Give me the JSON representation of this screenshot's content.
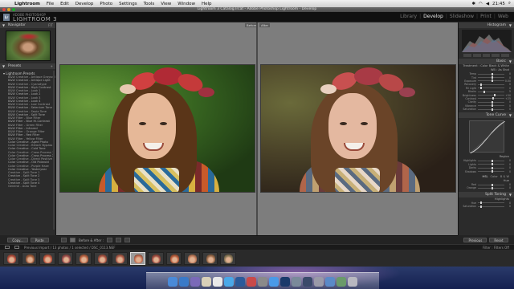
{
  "menubar": {
    "app": "Lightroom",
    "items": [
      "File",
      "Edit",
      "Develop",
      "Photo",
      "Settings",
      "Tools",
      "View",
      "Window",
      "Help"
    ],
    "clock": "21:45"
  },
  "window": {
    "title": "Lightroom 3 Catalog.lrcat - Adobe Photoshop Lightroom - Develop"
  },
  "identity": {
    "logo": "Lr",
    "subtitle": "ADOBE PHOTOSHOP",
    "app_name": "LIGHTROOM 3"
  },
  "modules": [
    "Library",
    "Develop",
    "Slideshow",
    "Print",
    "Web"
  ],
  "active_module": "Develop",
  "left_panel": {
    "navigator_header": "Navigator",
    "navigator_zoom": "FIT",
    "presets_header": "Presets",
    "folder": "Lightroom Presets",
    "presets": [
      "B&W Creative - Antique Grayscale",
      "B&W Creative - Antique Light",
      "B&W Creative - Cyanotype",
      "B&W Creative - High Contrast",
      "B&W Creative - Look 1",
      "B&W Creative - Look 2",
      "B&W Creative - Look 3",
      "B&W Creative - Look 4",
      "B&W Creative - Low Contrast",
      "B&W Creative - Selenium Tone",
      "B&W Creative - Sepia Tone",
      "B&W Creative - Split Tone",
      "B&W Filter - Blue Filter",
      "B&W Filter - Blue Hi-Contrast",
      "B&W Filter - Green Filter",
      "B&W Filter - Infrared",
      "B&W Filter - Orange Filter",
      "B&W Filter - Red Filter",
      "B&W Filter - Yellow Filter",
      "Color Creative - Aged Photo",
      "Color Creative - Bleach Bypass",
      "Color Creative - Cold Tone",
      "Color Creative - Cross Process 1",
      "Color Creative - Cross Process 2",
      "Color Creative - Direct Positive",
      "Color Creative - Old Polaroid",
      "Color Creative - Purple Haze",
      "Color Creative - Yesteryear",
      "Creative - Split Tone 1",
      "Creative - Split Tone 2",
      "Creative - Split Tone 3",
      "Creative - Split Tone 4",
      "General - Auto Tone"
    ],
    "copy_button": "Copy...",
    "paste_button": "Paste"
  },
  "center": {
    "before_label": "Before",
    "after_label": "After",
    "toolbar_label": "Before & After :"
  },
  "right_panel": {
    "histogram_header": "Histogram",
    "basic_header": "Basic",
    "treatment_label": "Treatment :",
    "treatment_options": [
      "Color",
      "Black & White"
    ],
    "wb_label": "WB :",
    "wb_value": "As Shot",
    "basic_sliders": [
      {
        "label": "Temp",
        "value": "0",
        "pos": 0.5
      },
      {
        "label": "Tint",
        "value": "0",
        "pos": 0.5
      },
      {
        "label": "Exposure",
        "value": "0.00",
        "pos": 0.5
      },
      {
        "label": "Recovery",
        "value": "0",
        "pos": 0.1
      },
      {
        "label": "Fill Light",
        "value": "0",
        "pos": 0.1
      },
      {
        "label": "Blacks",
        "value": "5",
        "pos": 0.2
      },
      {
        "label": "Brightness",
        "value": "+50",
        "pos": 0.6
      },
      {
        "label": "Contrast",
        "value": "+25",
        "pos": 0.55
      },
      {
        "label": "Clarity",
        "value": "0",
        "pos": 0.5
      },
      {
        "label": "Vibrance",
        "value": "0",
        "pos": 0.5
      },
      {
        "label": "Saturation",
        "value": "0",
        "pos": 0.5
      }
    ],
    "tone_curve_header": "Tone Curve",
    "region_label": "Region",
    "curve_sliders": [
      {
        "label": "Highlights",
        "value": "0",
        "pos": 0.5
      },
      {
        "label": "Lights",
        "value": "0",
        "pos": 0.5
      },
      {
        "label": "Darks",
        "value": "0",
        "pos": 0.5
      },
      {
        "label": "Shadows",
        "value": "0",
        "pos": 0.5
      }
    ],
    "hsl_tabs": [
      "HSL",
      "Color",
      "B & W"
    ],
    "hsl_label": "Hue",
    "hsl_sliders": [
      {
        "label": "Red",
        "value": "0",
        "pos": 0.5
      },
      {
        "label": "Orange",
        "value": "0",
        "pos": 0.5
      }
    ],
    "split_toning_header": "Split Toning",
    "split_label": "Highlights",
    "split_sliders": [
      {
        "label": "Hue",
        "value": "0",
        "pos": 0.1
      },
      {
        "label": "Saturation",
        "value": "0",
        "pos": 0.1
      }
    ],
    "previous_button": "Previous",
    "reset_button": "Reset"
  },
  "filmstrip": {
    "info": "Previous Import / 13 photos / 1 selected / DSC_0113.NEF",
    "filter_label": "Filter :",
    "filter_value": "Filters Off",
    "selected_index": 7,
    "count": 13
  },
  "dock": {
    "icons": [
      "finder-icon",
      "safari-icon",
      "app-icon",
      "mail-icon",
      "ical-icon",
      "itunes-icon",
      "app-icon",
      "app-icon",
      "app-icon",
      "itunes-icon",
      "photoshop-icon",
      "app-icon",
      "lightroom-icon",
      "app-icon",
      "folder-icon",
      "app-icon",
      "trash-icon"
    ]
  },
  "colors": {
    "accent": "#e6e6e6",
    "panel_bg": "#2b2b2b",
    "center_bg": "#7d7d7d"
  }
}
